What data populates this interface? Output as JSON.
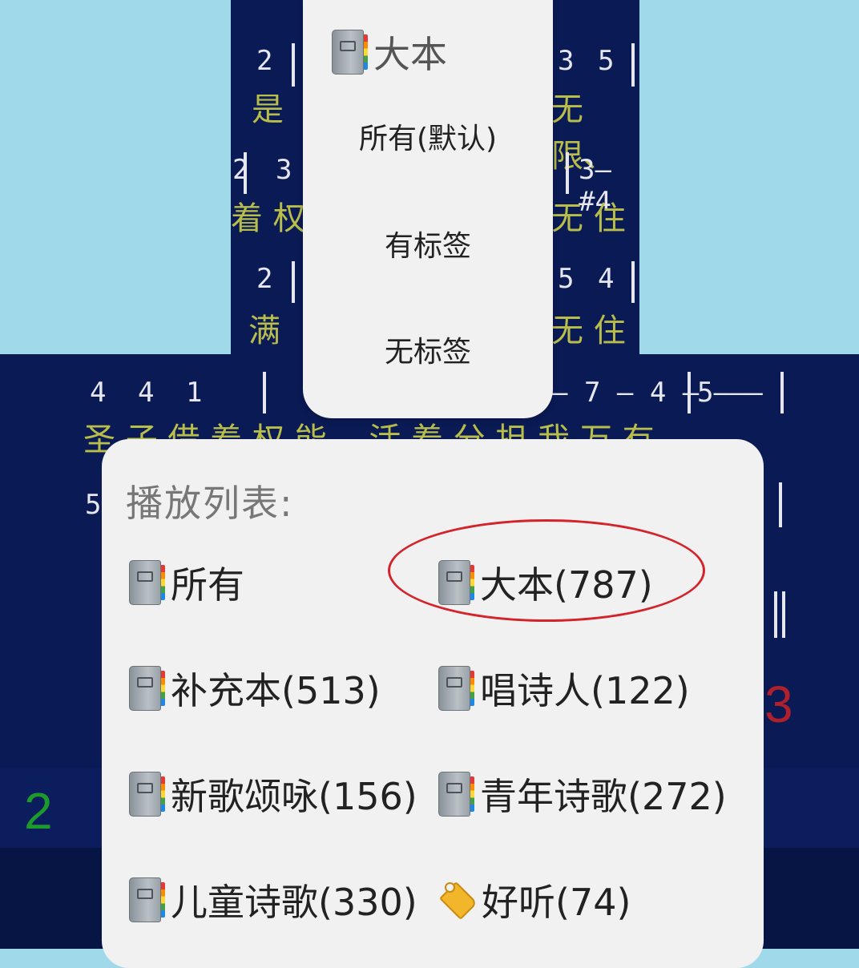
{
  "background": {
    "numbers": [
      "2",
      "3",
      "5",
      "2",
      "3",
      "3—#4",
      "2",
      "5",
      "4",
      "4",
      "4",
      "1",
      "— 7 — 4 —",
      "5———",
      "5",
      "3",
      "3"
    ],
    "lyrics": [
      "是",
      "无 限、",
      "着 权",
      "无 住 ",
      "满",
      "无 住",
      "圣 子 借 着 权 能 ，活 着 分 担 我 万 有，"
    ],
    "big_green": "2",
    "big_red": "3"
  },
  "popup": {
    "title": "大本",
    "items": [
      "所有(默认)",
      "有标签",
      "无标签"
    ]
  },
  "playlist": {
    "title": "播放列表:",
    "items": [
      {
        "label": "所有",
        "icon": "book-icon"
      },
      {
        "label": "大本(787)",
        "icon": "book-icon",
        "highlighted": true
      },
      {
        "label": "补充本(513)",
        "icon": "book-icon"
      },
      {
        "label": "唱诗人(122)",
        "icon": "book-icon"
      },
      {
        "label": "新歌颂咏(156)",
        "icon": "book-icon"
      },
      {
        "label": "青年诗歌(272)",
        "icon": "book-icon"
      },
      {
        "label": "儿童诗歌(330)",
        "icon": "book-icon"
      },
      {
        "label": "好听(74)",
        "icon": "tag-icon"
      }
    ]
  },
  "colors": {
    "background_navy": "#0a1a55",
    "lyric_yellow": "#b9bd4a",
    "highlight_red": "#d4232b",
    "panel": "#f1f1f1"
  }
}
